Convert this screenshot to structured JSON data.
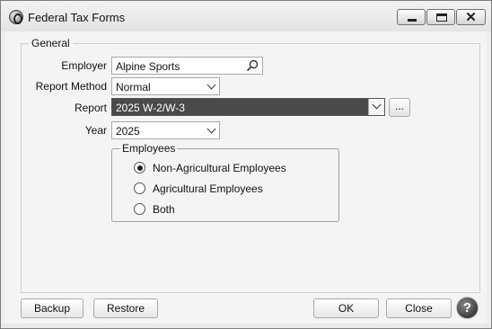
{
  "window": {
    "title": "Federal Tax Forms"
  },
  "general": {
    "legend": "General",
    "employer_label": "Employer",
    "employer_value": "Alpine Sports",
    "report_method_label": "Report Method",
    "report_method_value": "Normal",
    "report_label": "Report",
    "report_value": "2025 W-2/W-3",
    "report_more": "...",
    "year_label": "Year",
    "year_value": "2025"
  },
  "employees": {
    "legend": "Employees",
    "options": [
      {
        "label": "Non-Agricultural Employees",
        "checked": true
      },
      {
        "label": "Agricultural Employees",
        "checked": false
      },
      {
        "label": "Both",
        "checked": false
      }
    ]
  },
  "footer": {
    "backup": "Backup",
    "restore": "Restore",
    "ok": "OK",
    "close": "Close",
    "help": "?"
  },
  "icons": {
    "app": "app-icon",
    "search": "search-icon",
    "dropdown": "chevron-down-icon",
    "minimize": "minimize-icon",
    "maximize": "maximize-icon",
    "close": "close-icon",
    "help": "help-icon"
  }
}
